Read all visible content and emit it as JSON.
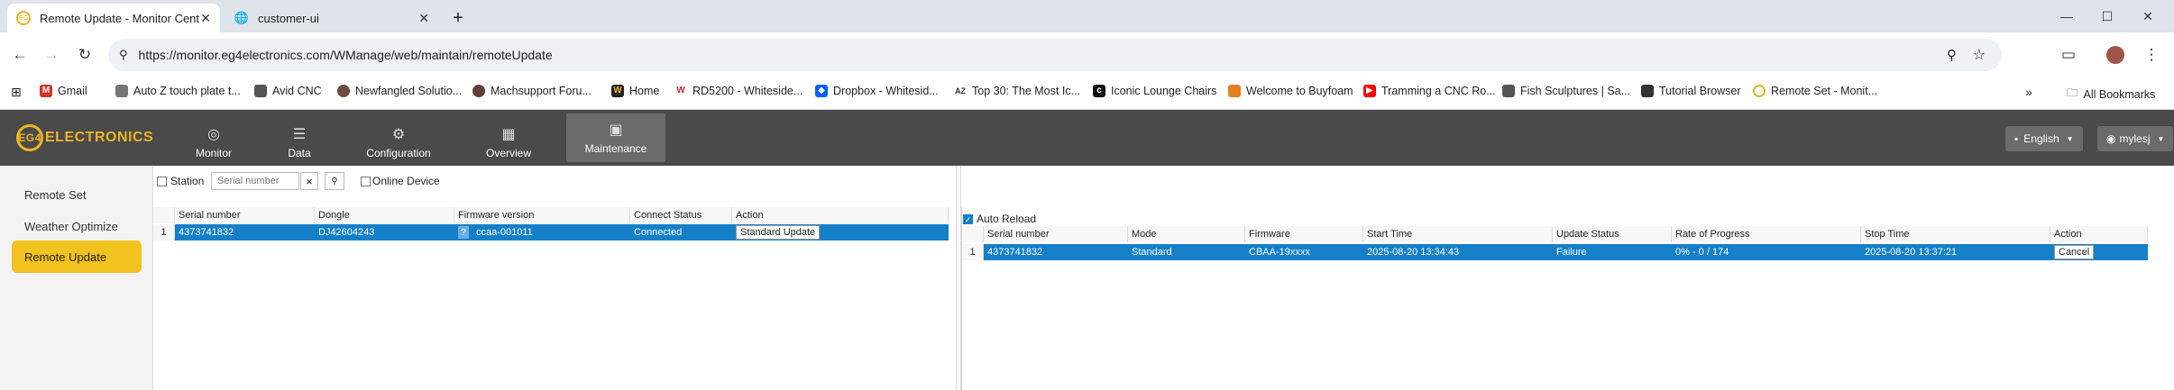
{
  "browser": {
    "tabs": [
      {
        "title": "Remote Update - Monitor Cent",
        "favicon": "eg4-icon",
        "active": true
      },
      {
        "title": "customer-ui",
        "favicon": "globe-icon",
        "active": false
      }
    ],
    "new_tab": "+",
    "url": "https://monitor.eg4electronics.com/WManage/web/maintain/remoteUpdate",
    "bookmarks": [
      {
        "label": "Gmail",
        "color": "#d93025"
      },
      {
        "label": "Auto Z touch plate t...",
        "color": "#777777"
      },
      {
        "label": "Avid CNC",
        "color": "#555555"
      },
      {
        "label": "Newfangled Solutio...",
        "color": "#6d4c41"
      },
      {
        "label": "Machsupport Foru...",
        "color": "#5d4037"
      },
      {
        "label": "Home",
        "color": "#222222"
      },
      {
        "label": "RD5200 - Whiteside...",
        "color": "#c62828"
      },
      {
        "label": "Dropbox - Whitesid...",
        "color": "#0061fe"
      },
      {
        "label": "Top 30: The Most Ic...",
        "color": "#333333"
      },
      {
        "label": "Iconic Lounge Chairs",
        "color": "#111111"
      },
      {
        "label": "Welcome to Buyfoam",
        "color": "#e67e22"
      },
      {
        "label": "Tramming a CNC Ro...",
        "color": "#ff0000"
      },
      {
        "label": "Fish Sculptures | Sa...",
        "color": "#555555"
      },
      {
        "label": "Tutorial Browser",
        "color": "#333333"
      },
      {
        "label": "Remote Set - Monit...",
        "color": "#e9b526"
      }
    ],
    "more": "»",
    "all_bookmarks": "All Bookmarks"
  },
  "app": {
    "logo_text": "ELECTRONICS",
    "logo_ring": "EG4",
    "nav": [
      {
        "label": "Monitor",
        "icon": "compass-icon",
        "glyph": "◎",
        "active": false
      },
      {
        "label": "Data",
        "icon": "database-icon",
        "glyph": "☰",
        "active": false
      },
      {
        "label": "Configuration",
        "icon": "gear-icon",
        "glyph": "⚙",
        "active": false
      },
      {
        "label": "Overview",
        "icon": "grid-icon",
        "glyph": "▦",
        "active": false
      },
      {
        "label": "Maintenance",
        "icon": "toolbox-icon",
        "glyph": "▣",
        "active": true
      }
    ],
    "language": "English",
    "user": "mylesj"
  },
  "sidebar": {
    "items": [
      {
        "label": "Remote Set",
        "active": false
      },
      {
        "label": "Weather Optimize",
        "active": false
      },
      {
        "label": "Remote Update",
        "active": true
      }
    ]
  },
  "filters": {
    "station_label": "Station",
    "serial_placeholder": "Serial number",
    "clear": "×",
    "search": "🔍",
    "online_label": "Online Device"
  },
  "left_table": {
    "headers": [
      "Serial number",
      "Dongle",
      "Firmware version",
      "Connect Status",
      "Action"
    ],
    "rows": [
      {
        "num": "1",
        "serial": "4373741832",
        "dongle": "DJ42604243",
        "badge": "?",
        "firmware": "ccaa-001011",
        "status": "Connected",
        "action": "Standard Update"
      }
    ]
  },
  "right_table": {
    "auto_reload": "Auto Reload",
    "headers": [
      "Serial number",
      "Mode",
      "Firmware",
      "Start Time",
      "Update Status",
      "Rate of Progress",
      "Stop Time",
      "Action"
    ],
    "rows": [
      {
        "num": "1",
        "serial": "4373741832",
        "mode": "Standard",
        "firmware": "CBAA-19xxxx",
        "start": "2025-08-20 13:34:43",
        "status": "Failure",
        "progress": "0% - 0 / 174",
        "stop": "2025-08-20 13:37:21",
        "action": "Cancel"
      }
    ]
  }
}
